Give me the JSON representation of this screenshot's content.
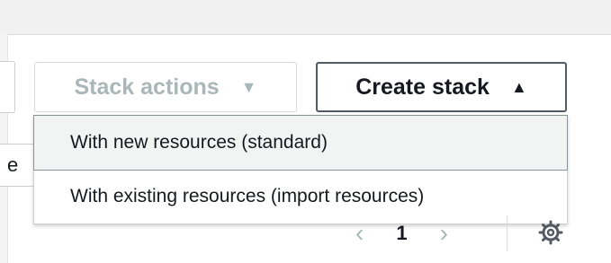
{
  "toolbar": {
    "stack_actions_label": "Stack actions",
    "stack_actions_caret": "▼",
    "create_stack_label": "Create stack",
    "create_stack_caret": "▲"
  },
  "partial_left_text": "e",
  "create_menu": {
    "items": [
      {
        "label": "With new resources (standard)"
      },
      {
        "label": "With existing resources (import resources)"
      }
    ]
  },
  "pagination": {
    "prev_glyph": "‹",
    "current_page": "1",
    "next_glyph": "›"
  },
  "icons": {
    "settings": "gear-icon"
  },
  "colors": {
    "disabled_text": "#aab7b8",
    "primary_text": "#16191f",
    "button_border": "#545b64",
    "highlight_bg": "#f2f3f3"
  }
}
